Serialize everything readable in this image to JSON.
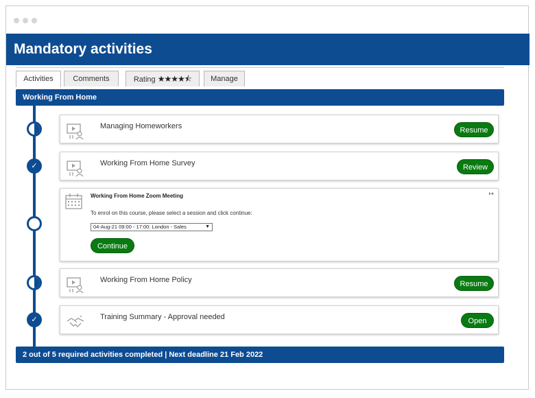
{
  "page_title": "Mandatory activities",
  "tabs": [
    {
      "label": "Activities"
    },
    {
      "label": "Comments"
    },
    {
      "label": "Rating",
      "stars": "★★★★⯪"
    },
    {
      "label": "Manage"
    }
  ],
  "section_title": "Working From Home",
  "activities": [
    {
      "title": "Managing Homeworkers",
      "button": "Resume",
      "status": "in-progress",
      "icon": "video-icon"
    },
    {
      "title": "Working From Home Survey",
      "button": "Review",
      "status": "completed",
      "icon": "video-icon"
    },
    {
      "title": "Working From Home Zoom Meeting",
      "instruction": "To enrol on this course, please select a session and click continue:",
      "session_selected": "04-Aug-21 09:00 - 17:00: London - Sales",
      "button": "Continue",
      "status": "not-started",
      "icon": "calendar-icon",
      "corner_icon": "↦"
    },
    {
      "title": "Working From Home Policy",
      "button": "Resume",
      "status": "in-progress",
      "icon": "video-icon"
    },
    {
      "title": "Training Summary - Approval needed",
      "button": "Open",
      "status": "completed",
      "icon": "handshake-icon"
    }
  ],
  "footer_text": "2 out of 5 required activities completed  |  Next deadline 21 Feb 2022",
  "colors": {
    "brand": "#0e4c92",
    "button": "#0a7a12"
  }
}
